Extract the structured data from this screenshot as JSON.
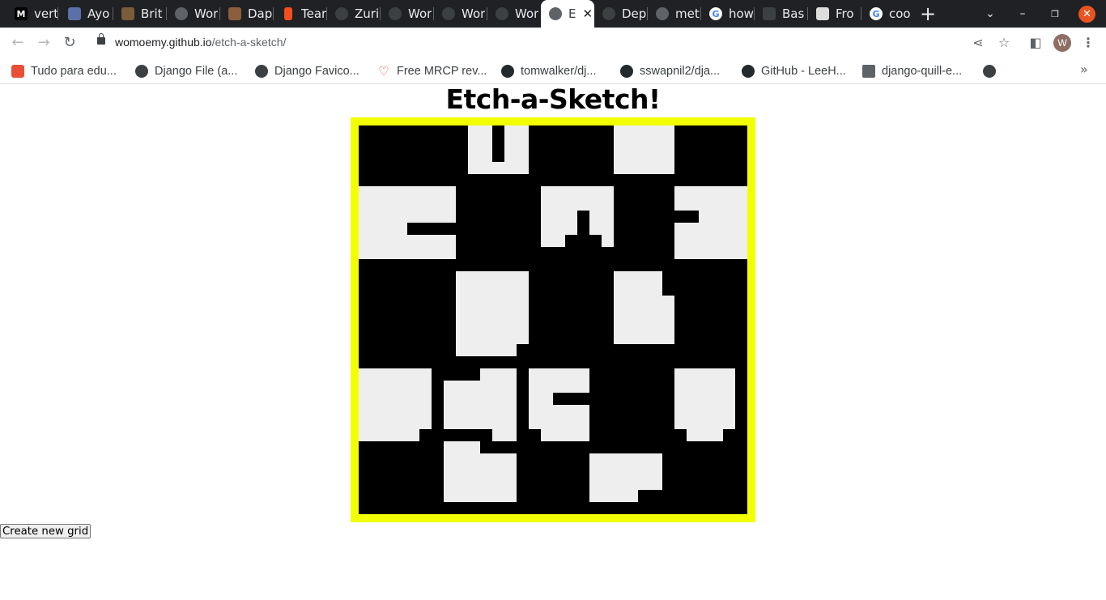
{
  "browser": {
    "tabs": [
      {
        "label": "vert",
        "icon": "medium-icon",
        "color": "#000000"
      },
      {
        "label": "Ayo",
        "icon": "avatar-image-icon",
        "color": "#5b6fa8"
      },
      {
        "label": "Brit",
        "icon": "person-icon",
        "color": "#7a5c3a"
      },
      {
        "label": "Wor",
        "icon": "globe-icon",
        "color": "#5f6368"
      },
      {
        "label": "Dap",
        "icon": "shoe-icon",
        "color": "#8b5e3c"
      },
      {
        "label": "Tear",
        "icon": "figma-icon",
        "color": "#f24e1e"
      },
      {
        "label": "Zuri",
        "icon": "github-icon",
        "color": "#3c4043"
      },
      {
        "label": "Wor",
        "icon": "github-icon",
        "color": "#3c4043"
      },
      {
        "label": "Wor",
        "icon": "github-icon",
        "color": "#3c4043"
      },
      {
        "label": "Wor",
        "icon": "github-icon",
        "color": "#3c4043"
      },
      {
        "label": "E",
        "icon": "globe-icon",
        "color": "#5f6368",
        "active": true
      },
      {
        "label": "Dep",
        "icon": "github-icon",
        "color": "#3c4043"
      },
      {
        "label": "met",
        "icon": "globe-icon",
        "color": "#5f6368"
      },
      {
        "label": "how",
        "icon": "google-icon",
        "color": "#4285f4"
      },
      {
        "label": "Bas",
        "icon": "page-icon",
        "color": "#5f6368"
      },
      {
        "label": "Fro",
        "icon": "image-icon",
        "color": "#dddddd"
      },
      {
        "label": "coo",
        "icon": "google-icon",
        "color": "#4285f4"
      }
    ],
    "url_host": "womoemy.github.io",
    "url_path": "/etch-a-sketch/",
    "avatar_letter": "W",
    "bookmarks": [
      {
        "label": "Tudo para edu...",
        "icon": "rainbow-icon",
        "color": "#e94f37"
      },
      {
        "label": "Django File (a...",
        "icon": "globe-icon",
        "color": "#3c4043"
      },
      {
        "label": "Django Favico...",
        "icon": "globe-icon",
        "color": "#3c4043"
      },
      {
        "label": "Free MRCP rev...",
        "icon": "heart-icon",
        "color": "#e53935"
      },
      {
        "label": "tomwalker/dj...",
        "icon": "github-icon",
        "color": "#24292e"
      },
      {
        "label": "sswapnil2/dja...",
        "icon": "github-icon",
        "color": "#24292e"
      },
      {
        "label": "GitHub - LeeH...",
        "icon": "github-icon",
        "color": "#24292e"
      },
      {
        "label": "django-quill-e...",
        "icon": "document-icon",
        "color": "#5f6368"
      },
      {
        "label": "",
        "icon": "globe-icon",
        "color": "#3c4043"
      }
    ]
  },
  "page": {
    "title": "Etch-a-Sketch!",
    "create_button": "Create new grid",
    "frame_color": "#f2ff00",
    "grid_background": "#000000",
    "cell_color": "#eeeeee"
  }
}
